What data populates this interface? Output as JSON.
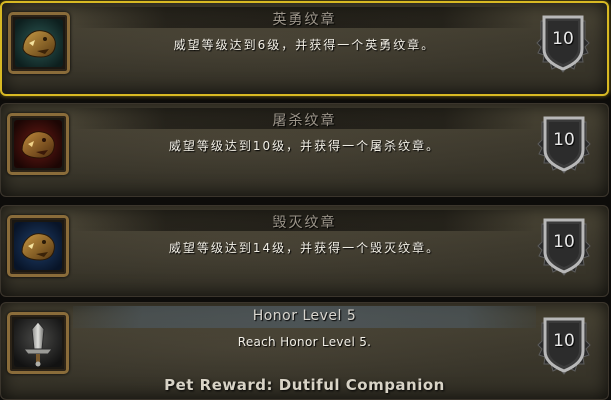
{
  "achievements": [
    {
      "title": "英勇纹章",
      "description": "威望等级达到6级，并获得一个英勇纹章。",
      "points": "10",
      "icon": "crest-heroic-icon",
      "selected": true
    },
    {
      "title": "屠杀纹章",
      "description": "威望等级达到10级，并获得一个屠杀纹章。",
      "points": "10",
      "icon": "crest-slaughter-icon",
      "selected": false
    },
    {
      "title": "毁灭纹章",
      "description": "威望等级达到14级，并获得一个毁灭纹章。",
      "points": "10",
      "icon": "crest-destruction-icon",
      "selected": false
    },
    {
      "title": "Honor Level 5",
      "description": "Reach Honor Level 5.",
      "points": "10",
      "reward": "Pet Reward: Dutiful Companion",
      "icon": "sword-honor-icon",
      "selected": false
    }
  ],
  "colors": {
    "selected_border": "#d8b923",
    "row_background": "#3d392d",
    "title_text": "#9c958a",
    "description_text": "#f2efe6"
  }
}
